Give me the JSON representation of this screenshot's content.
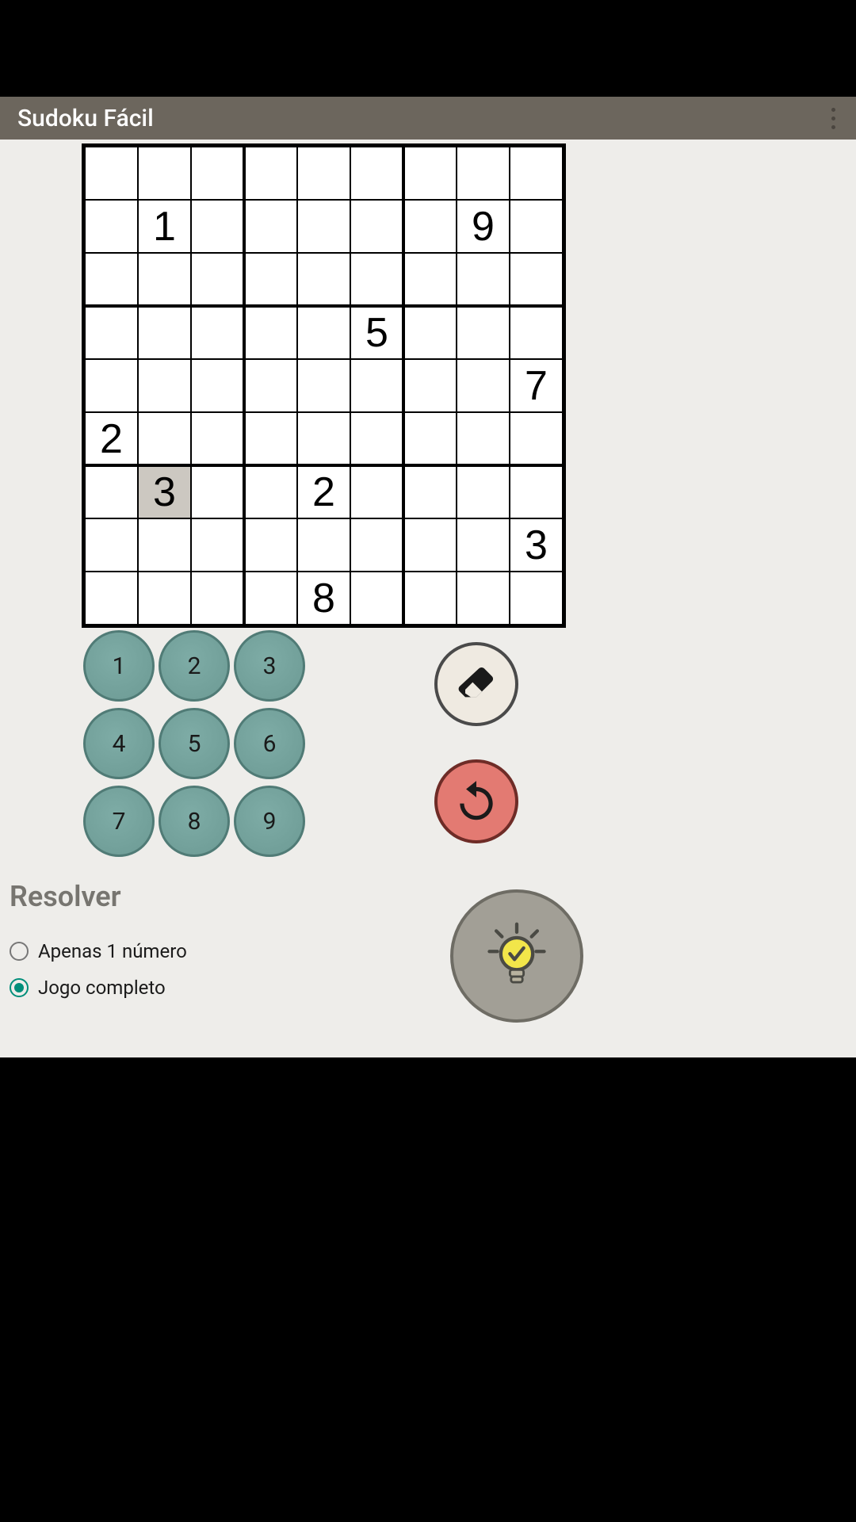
{
  "app": {
    "title": "Sudoku Fácil"
  },
  "board": {
    "given": [
      {
        "r": 1,
        "c": 1,
        "v": "1"
      },
      {
        "r": 1,
        "c": 7,
        "v": "9"
      },
      {
        "r": 3,
        "c": 5,
        "v": "5"
      },
      {
        "r": 4,
        "c": 8,
        "v": "7"
      },
      {
        "r": 5,
        "c": 0,
        "v": "2"
      },
      {
        "r": 6,
        "c": 1,
        "v": "3"
      },
      {
        "r": 6,
        "c": 4,
        "v": "2"
      },
      {
        "r": 7,
        "c": 8,
        "v": "3"
      },
      {
        "r": 8,
        "c": 4,
        "v": "8"
      }
    ],
    "selected": {
      "r": 6,
      "c": 1
    }
  },
  "keypad": {
    "labels": [
      "1",
      "2",
      "3",
      "4",
      "5",
      "6",
      "7",
      "8",
      "9"
    ]
  },
  "icons": {
    "erase": "eraser-icon",
    "undo": "undo-icon",
    "hint": "lightbulb-check-icon",
    "menu": "more-vertical-icon"
  },
  "resolver": {
    "title": "Resolver",
    "options": [
      {
        "label": "Apenas 1 número",
        "checked": false
      },
      {
        "label": "Jogo completo",
        "checked": true
      }
    ]
  }
}
